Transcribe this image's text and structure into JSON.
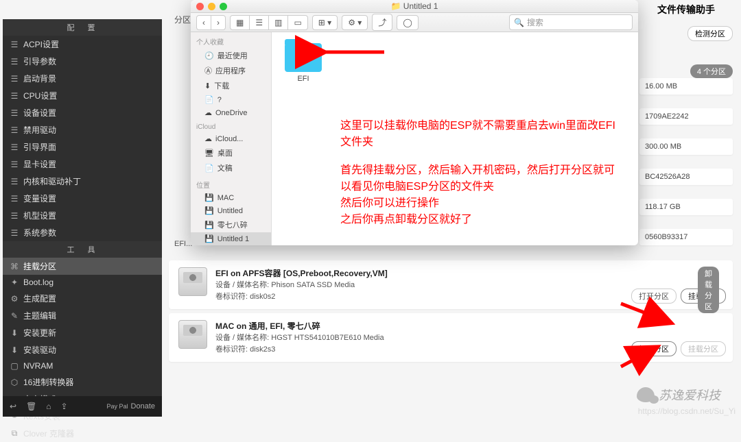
{
  "left_sidebar": {
    "section_config": "配　置",
    "config_items": [
      "ACPI设置",
      "引导参数",
      "启动背景",
      "CPU设置",
      "设备设置",
      "禁用驱动",
      "引导界面",
      "显卡设置",
      "内核和驱动补丁",
      "变量设置",
      "机型设置",
      "系统参数"
    ],
    "section_tools": "工　具",
    "tool_items": [
      {
        "label": "挂载分区",
        "active": true
      },
      {
        "label": "Boot.log"
      },
      {
        "label": "生成配置"
      },
      {
        "label": "主题编辑"
      },
      {
        "label": "安装更新"
      },
      {
        "label": "安装驱动"
      },
      {
        "label": "NVRAM"
      },
      {
        "label": "16进制转换器"
      },
      {
        "label": "文字模式"
      },
      {
        "label": "Kexts安装"
      },
      {
        "label": "Clover 克隆器"
      }
    ],
    "donate": "Donate",
    "paypal": "Pay\nPal"
  },
  "main": {
    "tab_label": "分区",
    "efi_label": "EFI..."
  },
  "right_col": {
    "header": "文件传输助手",
    "detect": "检测分区",
    "count": "4 个分区",
    "cells": [
      "16.00 MB",
      "1709AE2242",
      "300.00 MB",
      "BC42526A28",
      "118.17 GB",
      "0560B93317"
    ]
  },
  "partitions": [
    {
      "title": "EFI on APFS容器 [OS,Preboot,Recovery,VM]",
      "device_label": "设备 / 媒体名称:",
      "device": "Phison SATA SSD Media",
      "vol_label": "卷标识符:",
      "vol": "disk0s2",
      "open": "打开分区",
      "mount": "挂载分区",
      "mounted": false
    },
    {
      "title": "MAC on 通用, EFI, 零七八碎",
      "device_label": "设备 / 媒体名称:",
      "device": "HGST HTS541010B7E610 Media",
      "vol_label": "卷标识符:",
      "vol": "disk2s3",
      "open": "打开分区",
      "mount": "挂载分区",
      "unmount": "卸载分区",
      "mounted": true
    }
  ],
  "finder": {
    "title": "Untitled 1",
    "search_placeholder": "搜索",
    "sidebar": {
      "favorites": "个人收藏",
      "fav_items": [
        "最近使用",
        "应用程序",
        "下载",
        "?",
        "OneDrive"
      ],
      "icloud": "iCloud",
      "icloud_items": [
        "iCloud...",
        "桌面",
        "文稿"
      ],
      "locations": "位置",
      "loc_items": [
        "MAC",
        "Untitled",
        "零七八碎",
        "Untitled 1"
      ]
    },
    "folder_name": "EFI"
  },
  "annotations": {
    "line1": "这里可以挂载你电脑的ESP就不需要重启去win里面改EFI文件夹",
    "line2": "首先得挂载分区，然后输入开机密码，然后打开分区就可以看见你电脑ESP分区的文件夹",
    "line3": "然后你可以进行操作",
    "line4": "之后你再点卸载分区就好了"
  },
  "watermark": "https://blog.csdn.net/Su_Yi",
  "wechat": "苏逸爱科技"
}
